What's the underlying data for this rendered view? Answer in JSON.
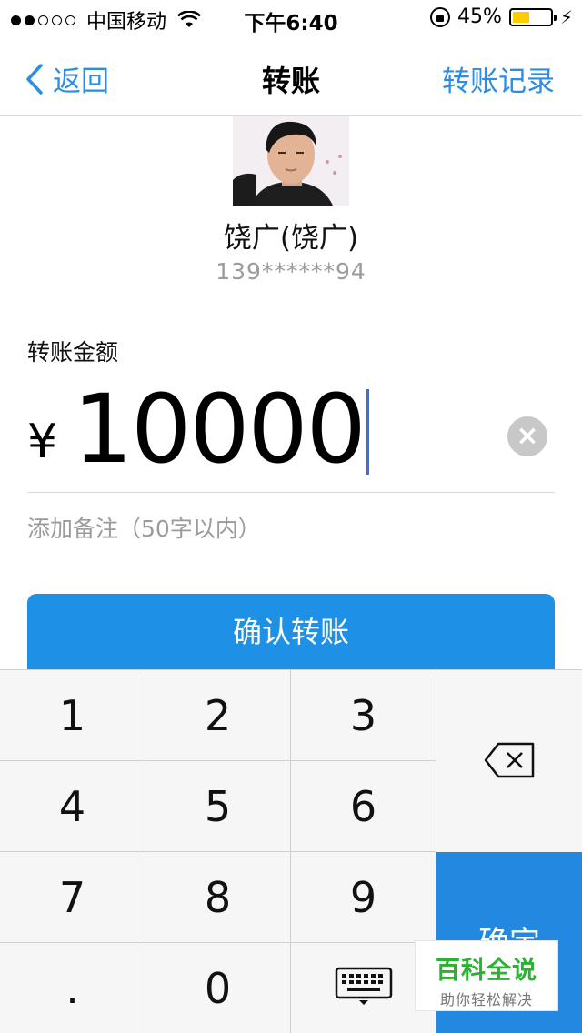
{
  "status_bar": {
    "signal_dots_filled": 2,
    "signal_dots_total": 5,
    "carrier": "中国移动",
    "time": "下午6:40",
    "battery_percent": "45%",
    "battery_level": 0.45,
    "battery_color": "#ffcc00"
  },
  "nav": {
    "back_label": "返回",
    "title": "转账",
    "right_label": "转账记录",
    "accent_color": "#2a8ee6"
  },
  "payee": {
    "name": "饶广(饶广)",
    "phone": "139******94"
  },
  "amount": {
    "label": "转账金额",
    "currency": "¥",
    "value": "10000",
    "clear_icon": "clear-icon"
  },
  "note": {
    "placeholder": "添加备注（50字以内）"
  },
  "confirm_button": {
    "label": "确认转账",
    "color": "#1e90e6"
  },
  "keypad": {
    "keys": [
      "1",
      "2",
      "3",
      "4",
      "5",
      "6",
      "7",
      "8",
      "9",
      ".",
      "0"
    ],
    "delete_icon": "backspace-icon",
    "done_label": "确定",
    "hide_icon": "keyboard-hide-icon",
    "done_color": "#2388e0"
  },
  "watermark": {
    "title": "百科全说",
    "subtitle": "助你轻松解决"
  }
}
